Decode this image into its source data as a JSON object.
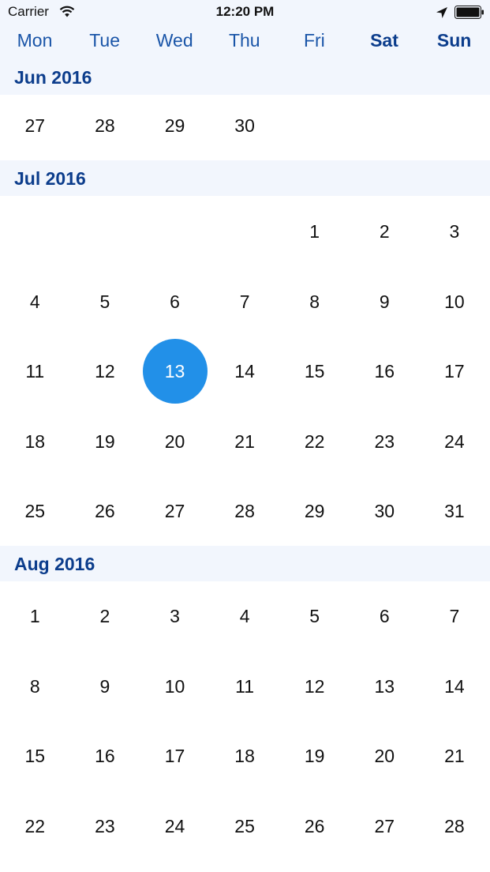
{
  "status_bar": {
    "carrier": "Carrier",
    "time": "12:20 PM",
    "icons": [
      "wifi-icon",
      "location-arrow-icon",
      "battery-icon"
    ]
  },
  "weekdays": [
    "Mon",
    "Tue",
    "Wed",
    "Thu",
    "Fri",
    "Sat",
    "Sun"
  ],
  "weekend_days": [
    "Sat",
    "Sun"
  ],
  "colors": {
    "header_bg": "#f2f6fd",
    "weekday_text": "#1a55a8",
    "month_text": "#0c3d8c",
    "selected_bg": "#2290e8"
  },
  "selected": {
    "month": "Jul 2016",
    "day": "13"
  },
  "months": [
    {
      "label": "Jun 2016",
      "weeks": [
        [
          "27",
          "28",
          "29",
          "30",
          "",
          "",
          ""
        ]
      ]
    },
    {
      "label": "Jul 2016",
      "weeks": [
        [
          "",
          "",
          "",
          "",
          "1",
          "2",
          "3"
        ],
        [
          "4",
          "5",
          "6",
          "7",
          "8",
          "9",
          "10"
        ],
        [
          "11",
          "12",
          "13",
          "14",
          "15",
          "16",
          "17"
        ],
        [
          "18",
          "19",
          "20",
          "21",
          "22",
          "23",
          "24"
        ],
        [
          "25",
          "26",
          "27",
          "28",
          "29",
          "30",
          "31"
        ]
      ]
    },
    {
      "label": "Aug 2016",
      "weeks": [
        [
          "1",
          "2",
          "3",
          "4",
          "5",
          "6",
          "7"
        ],
        [
          "8",
          "9",
          "10",
          "11",
          "12",
          "13",
          "14"
        ],
        [
          "15",
          "16",
          "17",
          "18",
          "19",
          "20",
          "21"
        ],
        [
          "22",
          "23",
          "24",
          "25",
          "26",
          "27",
          "28"
        ]
      ]
    }
  ]
}
